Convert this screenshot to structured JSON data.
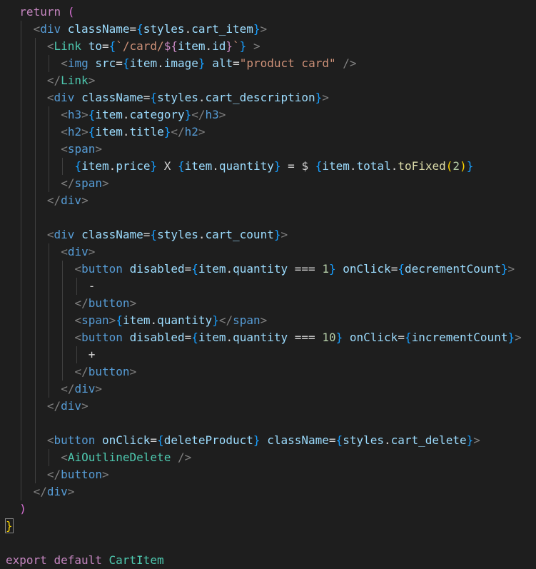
{
  "editor": {
    "background": "#1e1e1e",
    "lines": [
      {
        "indent": 1,
        "tokens": [
          [
            "kw",
            "return"
          ],
          [
            "txt",
            " "
          ],
          [
            "br2",
            "("
          ]
        ]
      },
      {
        "indent": 2,
        "tokens": [
          [
            "tag",
            "<"
          ],
          [
            "html",
            "div"
          ],
          [
            "txt",
            " "
          ],
          [
            "attr",
            "className"
          ],
          [
            "op",
            "="
          ],
          [
            "br3",
            "{"
          ],
          [
            "var",
            "styles"
          ],
          [
            "op",
            "."
          ],
          [
            "var",
            "cart_item"
          ],
          [
            "br3",
            "}"
          ],
          [
            "tag",
            ">"
          ]
        ]
      },
      {
        "indent": 3,
        "tokens": [
          [
            "tag",
            "<"
          ],
          [
            "comp",
            "Link"
          ],
          [
            "txt",
            " "
          ],
          [
            "attr",
            "to"
          ],
          [
            "op",
            "="
          ],
          [
            "br3",
            "{"
          ],
          [
            "str",
            "`/card/"
          ],
          [
            "kw",
            "${"
          ],
          [
            "var",
            "item"
          ],
          [
            "op",
            "."
          ],
          [
            "var",
            "id"
          ],
          [
            "kw",
            "}"
          ],
          [
            "str",
            "`"
          ],
          [
            "br3",
            "}"
          ],
          [
            "txt",
            " "
          ],
          [
            "tag",
            ">"
          ]
        ]
      },
      {
        "indent": 4,
        "tokens": [
          [
            "tag",
            "<"
          ],
          [
            "html",
            "img"
          ],
          [
            "txt",
            " "
          ],
          [
            "attr",
            "src"
          ],
          [
            "op",
            "="
          ],
          [
            "br3",
            "{"
          ],
          [
            "var",
            "item"
          ],
          [
            "op",
            "."
          ],
          [
            "var",
            "image"
          ],
          [
            "br3",
            "}"
          ],
          [
            "txt",
            " "
          ],
          [
            "attr",
            "alt"
          ],
          [
            "op",
            "="
          ],
          [
            "str",
            "\"product card\""
          ],
          [
            "txt",
            " "
          ],
          [
            "tag",
            "/>"
          ]
        ]
      },
      {
        "indent": 3,
        "tokens": [
          [
            "tag",
            "</"
          ],
          [
            "comp",
            "Link"
          ],
          [
            "tag",
            ">"
          ]
        ]
      },
      {
        "indent": 3,
        "tokens": [
          [
            "tag",
            "<"
          ],
          [
            "html",
            "div"
          ],
          [
            "txt",
            " "
          ],
          [
            "attr",
            "className"
          ],
          [
            "op",
            "="
          ],
          [
            "br3",
            "{"
          ],
          [
            "var",
            "styles"
          ],
          [
            "op",
            "."
          ],
          [
            "var",
            "cart_description"
          ],
          [
            "br3",
            "}"
          ],
          [
            "tag",
            ">"
          ]
        ]
      },
      {
        "indent": 4,
        "tokens": [
          [
            "tag",
            "<"
          ],
          [
            "html",
            "h3"
          ],
          [
            "tag",
            ">"
          ],
          [
            "br3",
            "{"
          ],
          [
            "var",
            "item"
          ],
          [
            "op",
            "."
          ],
          [
            "var",
            "category"
          ],
          [
            "br3",
            "}"
          ],
          [
            "tag",
            "</"
          ],
          [
            "html",
            "h3"
          ],
          [
            "tag",
            ">"
          ]
        ]
      },
      {
        "indent": 4,
        "tokens": [
          [
            "tag",
            "<"
          ],
          [
            "html",
            "h2"
          ],
          [
            "tag",
            ">"
          ],
          [
            "br3",
            "{"
          ],
          [
            "var",
            "item"
          ],
          [
            "op",
            "."
          ],
          [
            "var",
            "title"
          ],
          [
            "br3",
            "}"
          ],
          [
            "tag",
            "</"
          ],
          [
            "html",
            "h2"
          ],
          [
            "tag",
            ">"
          ]
        ]
      },
      {
        "indent": 4,
        "tokens": [
          [
            "tag",
            "<"
          ],
          [
            "html",
            "span"
          ],
          [
            "tag",
            ">"
          ]
        ]
      },
      {
        "indent": 5,
        "tokens": [
          [
            "br3",
            "{"
          ],
          [
            "var",
            "item"
          ],
          [
            "op",
            "."
          ],
          [
            "var",
            "price"
          ],
          [
            "br3",
            "}"
          ],
          [
            "txt",
            " X "
          ],
          [
            "br3",
            "{"
          ],
          [
            "var",
            "item"
          ],
          [
            "op",
            "."
          ],
          [
            "var",
            "quantity"
          ],
          [
            "br3",
            "}"
          ],
          [
            "txt",
            " = $ "
          ],
          [
            "br3",
            "{"
          ],
          [
            "var",
            "item"
          ],
          [
            "op",
            "."
          ],
          [
            "var",
            "total"
          ],
          [
            "op",
            "."
          ],
          [
            "fn",
            "toFixed"
          ],
          [
            "br1",
            "("
          ],
          [
            "num",
            "2"
          ],
          [
            "br1",
            ")"
          ],
          [
            "br3",
            "}"
          ]
        ]
      },
      {
        "indent": 4,
        "tokens": [
          [
            "tag",
            "</"
          ],
          [
            "html",
            "span"
          ],
          [
            "tag",
            ">"
          ]
        ]
      },
      {
        "indent": 3,
        "tokens": [
          [
            "tag",
            "</"
          ],
          [
            "html",
            "div"
          ],
          [
            "tag",
            ">"
          ]
        ]
      },
      {
        "indent": 0,
        "tokens": []
      },
      {
        "indent": 3,
        "tokens": [
          [
            "tag",
            "<"
          ],
          [
            "html",
            "div"
          ],
          [
            "txt",
            " "
          ],
          [
            "attr",
            "className"
          ],
          [
            "op",
            "="
          ],
          [
            "br3",
            "{"
          ],
          [
            "var",
            "styles"
          ],
          [
            "op",
            "."
          ],
          [
            "var",
            "cart_count"
          ],
          [
            "br3",
            "}"
          ],
          [
            "tag",
            ">"
          ]
        ]
      },
      {
        "indent": 4,
        "tokens": [
          [
            "tag",
            "<"
          ],
          [
            "html",
            "div"
          ],
          [
            "tag",
            ">"
          ]
        ]
      },
      {
        "indent": 5,
        "tokens": [
          [
            "tag",
            "<"
          ],
          [
            "html",
            "button"
          ],
          [
            "txt",
            " "
          ],
          [
            "attr",
            "disabled"
          ],
          [
            "op",
            "="
          ],
          [
            "br3",
            "{"
          ],
          [
            "var",
            "item"
          ],
          [
            "op",
            "."
          ],
          [
            "var",
            "quantity"
          ],
          [
            "op",
            " === "
          ],
          [
            "num",
            "1"
          ],
          [
            "br3",
            "}"
          ],
          [
            "txt",
            " "
          ],
          [
            "attr",
            "onClick"
          ],
          [
            "op",
            "="
          ],
          [
            "br3",
            "{"
          ],
          [
            "var",
            "decrementCount"
          ],
          [
            "br3",
            "}"
          ],
          [
            "tag",
            ">"
          ]
        ]
      },
      {
        "indent": 6,
        "tokens": [
          [
            "txt",
            "-"
          ]
        ]
      },
      {
        "indent": 5,
        "tokens": [
          [
            "tag",
            "</"
          ],
          [
            "html",
            "button"
          ],
          [
            "tag",
            ">"
          ]
        ]
      },
      {
        "indent": 5,
        "tokens": [
          [
            "tag",
            "<"
          ],
          [
            "html",
            "span"
          ],
          [
            "tag",
            ">"
          ],
          [
            "br3",
            "{"
          ],
          [
            "var",
            "item"
          ],
          [
            "op",
            "."
          ],
          [
            "var",
            "quantity"
          ],
          [
            "br3",
            "}"
          ],
          [
            "tag",
            "</"
          ],
          [
            "html",
            "span"
          ],
          [
            "tag",
            ">"
          ]
        ]
      },
      {
        "indent": 5,
        "tokens": [
          [
            "tag",
            "<"
          ],
          [
            "html",
            "button"
          ],
          [
            "txt",
            " "
          ],
          [
            "attr",
            "disabled"
          ],
          [
            "op",
            "="
          ],
          [
            "br3",
            "{"
          ],
          [
            "var",
            "item"
          ],
          [
            "op",
            "."
          ],
          [
            "var",
            "quantity"
          ],
          [
            "op",
            " === "
          ],
          [
            "num",
            "10"
          ],
          [
            "br3",
            "}"
          ],
          [
            "txt",
            " "
          ],
          [
            "attr",
            "onClick"
          ],
          [
            "op",
            "="
          ],
          [
            "br3",
            "{"
          ],
          [
            "var",
            "incrementCount"
          ],
          [
            "br3",
            "}"
          ],
          [
            "tag",
            ">"
          ]
        ]
      },
      {
        "indent": 6,
        "tokens": [
          [
            "txt",
            "+"
          ]
        ]
      },
      {
        "indent": 5,
        "tokens": [
          [
            "tag",
            "</"
          ],
          [
            "html",
            "button"
          ],
          [
            "tag",
            ">"
          ]
        ]
      },
      {
        "indent": 4,
        "tokens": [
          [
            "tag",
            "</"
          ],
          [
            "html",
            "div"
          ],
          [
            "tag",
            ">"
          ]
        ]
      },
      {
        "indent": 3,
        "tokens": [
          [
            "tag",
            "</"
          ],
          [
            "html",
            "div"
          ],
          [
            "tag",
            ">"
          ]
        ]
      },
      {
        "indent": 0,
        "tokens": []
      },
      {
        "indent": 3,
        "tokens": [
          [
            "tag",
            "<"
          ],
          [
            "html",
            "button"
          ],
          [
            "txt",
            " "
          ],
          [
            "attr",
            "onClick"
          ],
          [
            "op",
            "="
          ],
          [
            "br3",
            "{"
          ],
          [
            "var",
            "deleteProduct"
          ],
          [
            "br3",
            "}"
          ],
          [
            "txt",
            " "
          ],
          [
            "attr",
            "className"
          ],
          [
            "op",
            "="
          ],
          [
            "br3",
            "{"
          ],
          [
            "var",
            "styles"
          ],
          [
            "op",
            "."
          ],
          [
            "var",
            "cart_delete"
          ],
          [
            "br3",
            "}"
          ],
          [
            "tag",
            ">"
          ]
        ]
      },
      {
        "indent": 4,
        "tokens": [
          [
            "tag",
            "<"
          ],
          [
            "comp",
            "AiOutlineDelete"
          ],
          [
            "txt",
            " "
          ],
          [
            "tag",
            "/>"
          ]
        ]
      },
      {
        "indent": 3,
        "tokens": [
          [
            "tag",
            "</"
          ],
          [
            "html",
            "button"
          ],
          [
            "tag",
            ">"
          ]
        ]
      },
      {
        "indent": 2,
        "tokens": [
          [
            "tag",
            "</"
          ],
          [
            "html",
            "div"
          ],
          [
            "tag",
            ">"
          ]
        ]
      },
      {
        "indent": 1,
        "tokens": [
          [
            "br2",
            ")"
          ]
        ]
      },
      {
        "indent": 0,
        "tokens": [
          [
            "br1",
            "}"
          ]
        ],
        "boxed": true
      },
      {
        "indent": 0,
        "tokens": []
      },
      {
        "indent": 0,
        "tokens": [
          [
            "kw",
            "export"
          ],
          [
            "txt",
            " "
          ],
          [
            "kw",
            "default"
          ],
          [
            "txt",
            " "
          ],
          [
            "comp",
            "CartItem"
          ]
        ]
      }
    ]
  }
}
